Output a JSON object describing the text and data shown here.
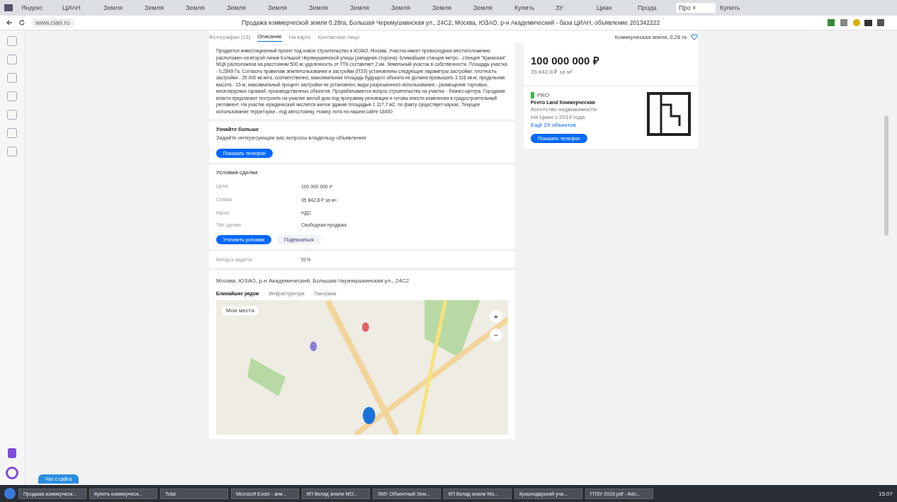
{
  "browser": {
    "tabs": [
      {
        "label": "Яндекс",
        "selected": false
      },
      {
        "label": "ЦИАН",
        "selected": false
      },
      {
        "label": "Земля",
        "selected": false
      },
      {
        "label": "Земля",
        "selected": false
      },
      {
        "label": "Земля",
        "selected": false
      },
      {
        "label": "Земля",
        "selected": false
      },
      {
        "label": "Земля",
        "selected": false
      },
      {
        "label": "Земля",
        "selected": false
      },
      {
        "label": "Земля",
        "selected": false
      },
      {
        "label": "Земля",
        "selected": false
      },
      {
        "label": "Земля",
        "selected": false
      },
      {
        "label": "Земля",
        "selected": false
      },
      {
        "label": "Купить",
        "selected": false
      },
      {
        "label": "ЗУ",
        "selected": false
      },
      {
        "label": "Циан",
        "selected": false
      },
      {
        "label": "Прода",
        "selected": false
      },
      {
        "label": "Про ×",
        "selected": true
      },
      {
        "label": "Купить",
        "selected": false
      }
    ],
    "address": "www.cian.ru",
    "page_title": "Продажа коммерческой земли 0,28га, Большая Черемушкинская ул., 24С2, Москва, ЮЗАО, р-н Академический - база ЦИАН, объявление 201342222"
  },
  "nav": {
    "tabs": [
      {
        "label": "Фотографии (13)",
        "selected": false
      },
      {
        "label": "Описание",
        "selected": true
      },
      {
        "label": "На карте",
        "selected": false
      },
      {
        "label": "Контактное лицо",
        "selected": false
      }
    ],
    "summary": "Коммерческая земля, 0,28 га"
  },
  "description": "Продается инвестиционный проект под новое строительство в ЮЗАО, Москва. Участок имеет превосходное местоположение: расположен на второй линии Большой Черемушкинской улицы (западная сторона). Ближайшая станция метро - станция \"Крымская\" МЦК расположена на расстоянии 500 м; удаленность от ТТК составляет 2 км. Земельный участок в собственности. Площадь участка - 0,2849 Га. Согласно правилам землепользования и застройки (ПЗЗ) установлены следующие параметры застройки: плотность застройки - 25 000 кв.м/га, соответственно, максимальная площадь будущего объекта не должна превышать 3 116 кв.м; предельная высота - 15 м; максимальный процент застройки не установлен; виды разрешенного использования - размещение торговых, многоярусных гаражей, производственных объектов. Прорабатывается вопрос строительства на участке - бизнес-центра. Городские власти предлагают построить на участке жилой дом под программу реновации и готовы внести изменения в градостроительный регламент. На участке юридический числится жилое здание площадью 1 117,7 м2, по факту существует каркас. Текущее использование территории - под автостоянку. Номер лота на нашем сайте 18400",
  "learn_more": {
    "title": "Узнайте больше",
    "text": "Задайте интересующие вас вопросы владельцу объявления",
    "button": "Показать телефон"
  },
  "deal": {
    "title": "Условия сделки",
    "rows": [
      {
        "label": "Цена",
        "value": "100 000 000 ₽"
      },
      {
        "label": "Ставка",
        "value": "35 842,8 ₽ за м²"
      },
      {
        "label": "Налог",
        "value": "НДС"
      },
      {
        "label": "Тип сделки",
        "value": "Свободная продажа"
      }
    ],
    "primary_button": "Уточнить условия",
    "secondary_button": "Подписаться"
  },
  "extra": {
    "label": "Вклад в задаток",
    "value": "51%"
  },
  "location": {
    "address": "Москва, ЮЗАО, р-н Академический, Большая Черемушкинская ул., 24С2",
    "tabs": [
      {
        "label": "Ближайшие рядом",
        "selected": true
      },
      {
        "label": "Инфраструктура",
        "selected": false
      },
      {
        "label": "Панорама",
        "selected": false
      }
    ],
    "map_chip": "Мои места",
    "zoom_in": "+",
    "zoom_out": "−"
  },
  "price_card": {
    "price": "100 000 000 ₽",
    "per_unit": "35 842,8 ₽ за м²"
  },
  "agent": {
    "badge": "PRO",
    "name": "Ренто Land Коммерческая",
    "type": "Агентство недвижимости",
    "since": "На Циан с 2019 года",
    "more": "Ещё 29 объектов",
    "button": "Показать телефон"
  },
  "chat_button": "Чат с сайта",
  "taskbar": {
    "items": [
      "Продажа коммерческ...",
      "Купить коммерческ...",
      "Total",
      "Microsoft Excel - зем...",
      "КП Вклад земли МО...",
      "ЗМУ Объектный Зем...",
      "КП Вклад земли Mo...",
      "Краснодарский уча...",
      "ГПЗУ 2019.pdf - Ado..."
    ],
    "clock": "15:07"
  }
}
